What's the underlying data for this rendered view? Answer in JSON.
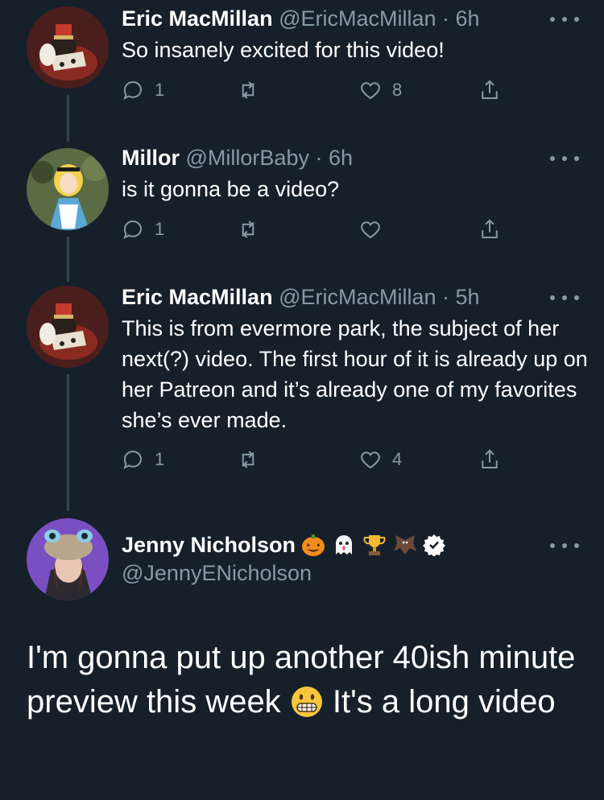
{
  "tweets": [
    {
      "name": "Eric MacMillan",
      "handle": "@EricMacMillan",
      "time": "6h",
      "text": "So insanely excited for this video!",
      "replies": "1",
      "retweets": "",
      "likes": "8"
    },
    {
      "name": "Millor",
      "handle": "@MillorBaby",
      "time": "6h",
      "text": "is it gonna be a video?",
      "replies": "1",
      "retweets": "",
      "likes": ""
    },
    {
      "name": "Eric MacMillan",
      "handle": "@EricMacMillan",
      "time": "5h",
      "text": "This is from evermore park, the subject of her next(?) video. The first hour of it is already up on her Patreon and it’s already one of my favorites she’s ever made.",
      "replies": "1",
      "retweets": "",
      "likes": "4"
    }
  ],
  "main_tweet": {
    "name": "Jenny Nicholson",
    "handle": "@JennyENicholson",
    "name_emojis": [
      "jack-o-lantern-emoji",
      "ghost-emoji",
      "trophy-emoji",
      "bat-emoji"
    ],
    "text_before": "I'm gonna put up another 40ish minute preview this week",
    "text_emoji": "grimacing-face-emoji",
    "text_after": " It's a long video"
  },
  "colors": {
    "background": "#15202b",
    "secondary_text": "#8899a6",
    "thread_line": "#38444d",
    "verified_badge": "#ffffff"
  }
}
